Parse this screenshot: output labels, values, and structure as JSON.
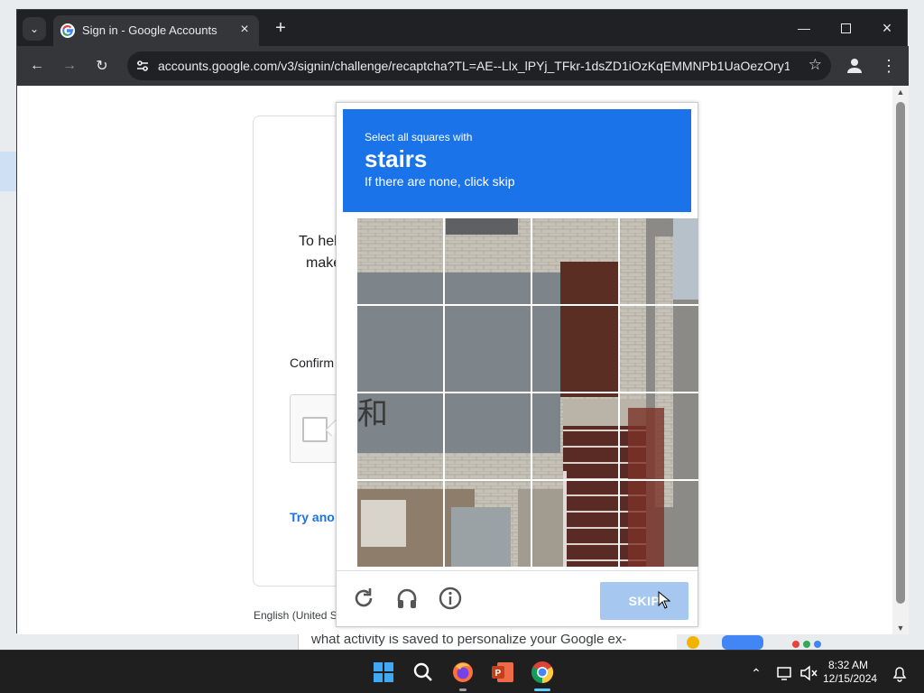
{
  "browser": {
    "tab_title": "Sign in - Google Accounts",
    "url": "accounts.google.com/v3/signin/challenge/recaptcha?TL=AE--Llx_lPYj_TFkr-1dsZD1iOzKqEMMNPb1UaOezOry1j...",
    "icons": [
      "tab-list-icon",
      "google-favicon",
      "close-tab-icon",
      "new-tab-icon",
      "minimize-icon",
      "maximize-icon",
      "close-window-icon",
      "back-icon",
      "forward-icon",
      "reload-icon",
      "site-settings-icon",
      "bookmark-star-icon",
      "profile-icon",
      "menu-kebab-icon"
    ]
  },
  "signin": {
    "partial_line1": "To hel",
    "partial_line2": "make",
    "confirm": "Confirm",
    "try_another": "Try ano",
    "language": "English (United S"
  },
  "captcha": {
    "line1": "Select all squares with",
    "keyword": "stairs",
    "line3": "If there are none, click skip",
    "skip_label": "SKIP",
    "grid_rows": 4,
    "grid_cols": 4,
    "header_color": "#1a73e8",
    "footer_icons": [
      "reload-icon",
      "audio-challenge-icon",
      "info-icon"
    ]
  },
  "desktop": {
    "background_text": "what activity is saved to personalize your Google ex-"
  },
  "taskbar": {
    "apps": [
      "windows-start-icon",
      "search-icon",
      "firefox-icon",
      "powerpoint-icon",
      "chrome-icon"
    ],
    "time": "8:32 AM",
    "date": "12/15/2024"
  }
}
